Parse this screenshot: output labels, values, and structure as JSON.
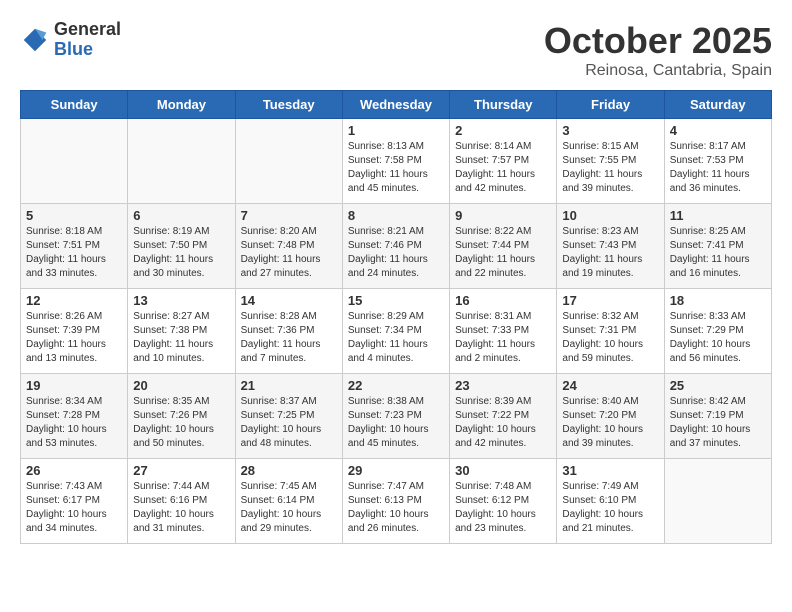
{
  "header": {
    "logo_general": "General",
    "logo_blue": "Blue",
    "month_title": "October 2025",
    "subtitle": "Reinosa, Cantabria, Spain"
  },
  "weekdays": [
    "Sunday",
    "Monday",
    "Tuesday",
    "Wednesday",
    "Thursday",
    "Friday",
    "Saturday"
  ],
  "weeks": [
    [
      {
        "day": "",
        "info": ""
      },
      {
        "day": "",
        "info": ""
      },
      {
        "day": "",
        "info": ""
      },
      {
        "day": "1",
        "info": "Sunrise: 8:13 AM\nSunset: 7:58 PM\nDaylight: 11 hours\nand 45 minutes."
      },
      {
        "day": "2",
        "info": "Sunrise: 8:14 AM\nSunset: 7:57 PM\nDaylight: 11 hours\nand 42 minutes."
      },
      {
        "day": "3",
        "info": "Sunrise: 8:15 AM\nSunset: 7:55 PM\nDaylight: 11 hours\nand 39 minutes."
      },
      {
        "day": "4",
        "info": "Sunrise: 8:17 AM\nSunset: 7:53 PM\nDaylight: 11 hours\nand 36 minutes."
      }
    ],
    [
      {
        "day": "5",
        "info": "Sunrise: 8:18 AM\nSunset: 7:51 PM\nDaylight: 11 hours\nand 33 minutes."
      },
      {
        "day": "6",
        "info": "Sunrise: 8:19 AM\nSunset: 7:50 PM\nDaylight: 11 hours\nand 30 minutes."
      },
      {
        "day": "7",
        "info": "Sunrise: 8:20 AM\nSunset: 7:48 PM\nDaylight: 11 hours\nand 27 minutes."
      },
      {
        "day": "8",
        "info": "Sunrise: 8:21 AM\nSunset: 7:46 PM\nDaylight: 11 hours\nand 24 minutes."
      },
      {
        "day": "9",
        "info": "Sunrise: 8:22 AM\nSunset: 7:44 PM\nDaylight: 11 hours\nand 22 minutes."
      },
      {
        "day": "10",
        "info": "Sunrise: 8:23 AM\nSunset: 7:43 PM\nDaylight: 11 hours\nand 19 minutes."
      },
      {
        "day": "11",
        "info": "Sunrise: 8:25 AM\nSunset: 7:41 PM\nDaylight: 11 hours\nand 16 minutes."
      }
    ],
    [
      {
        "day": "12",
        "info": "Sunrise: 8:26 AM\nSunset: 7:39 PM\nDaylight: 11 hours\nand 13 minutes."
      },
      {
        "day": "13",
        "info": "Sunrise: 8:27 AM\nSunset: 7:38 PM\nDaylight: 11 hours\nand 10 minutes."
      },
      {
        "day": "14",
        "info": "Sunrise: 8:28 AM\nSunset: 7:36 PM\nDaylight: 11 hours\nand 7 minutes."
      },
      {
        "day": "15",
        "info": "Sunrise: 8:29 AM\nSunset: 7:34 PM\nDaylight: 11 hours\nand 4 minutes."
      },
      {
        "day": "16",
        "info": "Sunrise: 8:31 AM\nSunset: 7:33 PM\nDaylight: 11 hours\nand 2 minutes."
      },
      {
        "day": "17",
        "info": "Sunrise: 8:32 AM\nSunset: 7:31 PM\nDaylight: 10 hours\nand 59 minutes."
      },
      {
        "day": "18",
        "info": "Sunrise: 8:33 AM\nSunset: 7:29 PM\nDaylight: 10 hours\nand 56 minutes."
      }
    ],
    [
      {
        "day": "19",
        "info": "Sunrise: 8:34 AM\nSunset: 7:28 PM\nDaylight: 10 hours\nand 53 minutes."
      },
      {
        "day": "20",
        "info": "Sunrise: 8:35 AM\nSunset: 7:26 PM\nDaylight: 10 hours\nand 50 minutes."
      },
      {
        "day": "21",
        "info": "Sunrise: 8:37 AM\nSunset: 7:25 PM\nDaylight: 10 hours\nand 48 minutes."
      },
      {
        "day": "22",
        "info": "Sunrise: 8:38 AM\nSunset: 7:23 PM\nDaylight: 10 hours\nand 45 minutes."
      },
      {
        "day": "23",
        "info": "Sunrise: 8:39 AM\nSunset: 7:22 PM\nDaylight: 10 hours\nand 42 minutes."
      },
      {
        "day": "24",
        "info": "Sunrise: 8:40 AM\nSunset: 7:20 PM\nDaylight: 10 hours\nand 39 minutes."
      },
      {
        "day": "25",
        "info": "Sunrise: 8:42 AM\nSunset: 7:19 PM\nDaylight: 10 hours\nand 37 minutes."
      }
    ],
    [
      {
        "day": "26",
        "info": "Sunrise: 7:43 AM\nSunset: 6:17 PM\nDaylight: 10 hours\nand 34 minutes."
      },
      {
        "day": "27",
        "info": "Sunrise: 7:44 AM\nSunset: 6:16 PM\nDaylight: 10 hours\nand 31 minutes."
      },
      {
        "day": "28",
        "info": "Sunrise: 7:45 AM\nSunset: 6:14 PM\nDaylight: 10 hours\nand 29 minutes."
      },
      {
        "day": "29",
        "info": "Sunrise: 7:47 AM\nSunset: 6:13 PM\nDaylight: 10 hours\nand 26 minutes."
      },
      {
        "day": "30",
        "info": "Sunrise: 7:48 AM\nSunset: 6:12 PM\nDaylight: 10 hours\nand 23 minutes."
      },
      {
        "day": "31",
        "info": "Sunrise: 7:49 AM\nSunset: 6:10 PM\nDaylight: 10 hours\nand 21 minutes."
      },
      {
        "day": "",
        "info": ""
      }
    ]
  ]
}
